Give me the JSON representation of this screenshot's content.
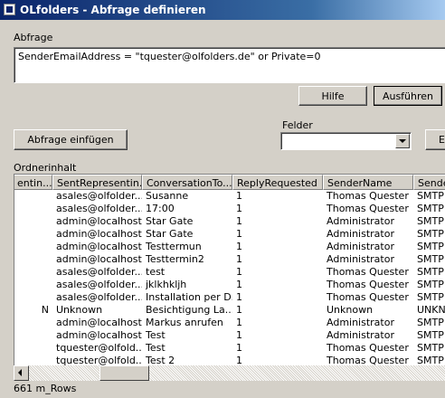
{
  "window": {
    "title": "OLfolders - Abfrage definieren"
  },
  "query": {
    "label": "Abfrage",
    "value": "SenderEmailAddress = \"tquester@olfolders.de\" or Private=0"
  },
  "buttons": {
    "help": "Hilfe",
    "execute": "Ausführen",
    "insert_query": "Abfrage einfügen",
    "e_partial": "E"
  },
  "fields": {
    "label": "Felder",
    "selected": ""
  },
  "grid": {
    "label": "Ordnerinhalt",
    "columns": [
      "entin...",
      "SentRepresentin...",
      "ConversationTo...",
      "ReplyRequested",
      "SenderName",
      "Sender"
    ],
    "rows": [
      [
        "",
        "asales@olfolder...",
        "Susanne",
        "1",
        "Thomas Quester",
        "SMTP"
      ],
      [
        "",
        "asales@olfolder...",
        "17:00",
        "1",
        "Thomas Quester",
        "SMTP"
      ],
      [
        "",
        "admin@localhost",
        "Star Gate",
        "1",
        "Administrator",
        "SMTP"
      ],
      [
        "",
        "admin@localhost",
        "Star Gate",
        "1",
        "Administrator",
        "SMTP"
      ],
      [
        "",
        "admin@localhost",
        "Testtermun",
        "1",
        "Administrator",
        "SMTP"
      ],
      [
        "",
        "admin@localhost",
        "Testtermin2",
        "1",
        "Administrator",
        "SMTP"
      ],
      [
        "",
        "asales@olfolder...",
        "test",
        "1",
        "Thomas Quester",
        "SMTP"
      ],
      [
        "",
        "asales@olfolder...",
        "jklkhkljh",
        "1",
        "Thomas Quester",
        "SMTP"
      ],
      [
        "",
        "asales@olfolder...",
        "Installation per D...",
        "1",
        "Thomas Quester",
        "SMTP"
      ],
      [
        "N",
        "Unknown",
        "Besichtigung La...",
        "1",
        "Unknown",
        "UNKN"
      ],
      [
        "",
        "admin@localhost",
        "Markus anrufen",
        "1",
        "Administrator",
        "SMTP"
      ],
      [
        "",
        "admin@localhost",
        "Test",
        "1",
        "Administrator",
        "SMTP"
      ],
      [
        "",
        "tquester@olfold...",
        "Test",
        "1",
        "Thomas Quester",
        "SMTP"
      ],
      [
        "",
        "tquester@olfold...",
        "Test 2",
        "1",
        "Thomas Quester",
        "SMTP"
      ]
    ]
  },
  "status": {
    "rows": "661 m_Rows"
  }
}
